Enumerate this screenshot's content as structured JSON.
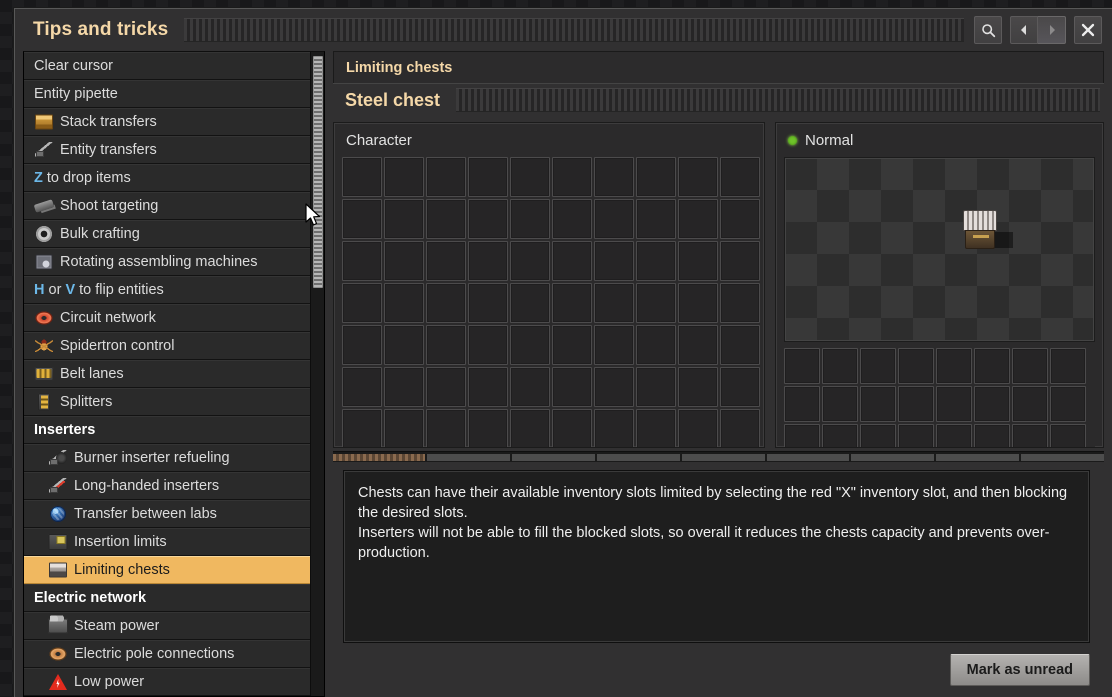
{
  "window": {
    "title": "Tips and tricks",
    "drag_handle": "window-drag-handle"
  },
  "titlebar_buttons": [
    {
      "name": "search-button",
      "icon": "search-icon"
    },
    {
      "name": "back-button",
      "icon": "arrow-left-icon"
    },
    {
      "name": "forward-button",
      "icon": "arrow-right-icon"
    },
    {
      "name": "close-button",
      "icon": "close-icon"
    }
  ],
  "sidebar": {
    "items": [
      {
        "label": "Clear cursor",
        "icon": null,
        "type": "item",
        "indent": false
      },
      {
        "label": "Entity pipette",
        "icon": null,
        "type": "item",
        "indent": false
      },
      {
        "label": "Stack transfers",
        "icon": "wooden-chest-icon",
        "type": "item",
        "indent": false
      },
      {
        "label": "Entity transfers",
        "icon": "entity-transfer-icon",
        "type": "item",
        "indent": false
      },
      {
        "label": "Z to drop items",
        "icon": null,
        "type": "item",
        "indent": false,
        "key": "Z",
        "rest": " to drop items"
      },
      {
        "label": "Shoot targeting",
        "icon": "pistol-icon",
        "type": "item",
        "indent": false
      },
      {
        "label": "Bulk crafting",
        "icon": "gear-icon",
        "type": "item",
        "indent": false
      },
      {
        "label": "Rotating assembling machines",
        "icon": "assembling-machine-icon",
        "type": "item",
        "indent": false
      },
      {
        "label": "H or V to flip entities",
        "icon": null,
        "type": "item",
        "indent": false,
        "key": "H",
        "key2": "V",
        "mid": " or ",
        "rest": " to flip entities"
      },
      {
        "label": "Circuit network",
        "icon": "red-wire-icon",
        "type": "item",
        "indent": false
      },
      {
        "label": "Spidertron control",
        "icon": "spidertron-icon",
        "type": "item",
        "indent": false
      },
      {
        "label": "Belt lanes",
        "icon": "transport-belt-icon",
        "type": "item",
        "indent": false
      },
      {
        "label": "Splitters",
        "icon": "splitter-icon",
        "type": "item",
        "indent": false
      },
      {
        "label": "Inserters",
        "icon": null,
        "type": "header",
        "indent": false
      },
      {
        "label": "Burner inserter refueling",
        "icon": "burner-inserter-icon",
        "type": "item",
        "indent": true
      },
      {
        "label": "Long-handed inserters",
        "icon": "long-handed-inserter-icon",
        "type": "item",
        "indent": true
      },
      {
        "label": "Transfer between labs",
        "icon": "lab-icon",
        "type": "item",
        "indent": true
      },
      {
        "label": "Insertion limits",
        "icon": "insertion-limit-icon",
        "type": "item",
        "indent": true
      },
      {
        "label": "Limiting chests",
        "icon": "steel-chest-icon",
        "type": "item",
        "indent": true,
        "selected": true
      },
      {
        "label": "Electric network",
        "icon": null,
        "type": "header",
        "indent": false
      },
      {
        "label": "Steam power",
        "icon": "steam-engine-icon",
        "type": "item",
        "indent": true
      },
      {
        "label": "Electric pole connections",
        "icon": "copper-wire-icon",
        "type": "item",
        "indent": true
      },
      {
        "label": "Low power",
        "icon": "low-power-warning-icon",
        "type": "item",
        "indent": true
      }
    ],
    "selected_label": "Limiting chests"
  },
  "content": {
    "breadcrumb": "Limiting chests",
    "subtitle": "Steel chest",
    "left_panel": {
      "title": "Character",
      "grid_columns": 10,
      "grid_rows": 8
    },
    "right_panel": {
      "title": "Normal",
      "status_color": "#6fc22a",
      "preview_entity": "steel-chest",
      "grid_columns": 8,
      "grid_rows": 3
    },
    "description": {
      "paragraph_1": "Chests can have their available inventory slots limited by selecting the red \"X\" inventory slot, and then blocking the desired slots.",
      "paragraph_2": "Inserters will not be able to fill the blocked slots, so overall it reduces the chests capacity and prevents over-production."
    },
    "mark_unread_label": "Mark as unread",
    "timeline_segments": 9
  },
  "colors": {
    "accent_text": "#f5d8a8",
    "selected_row": "#f0b860",
    "key_hint": "#6cb8e8",
    "status_green": "#6fc22a"
  }
}
